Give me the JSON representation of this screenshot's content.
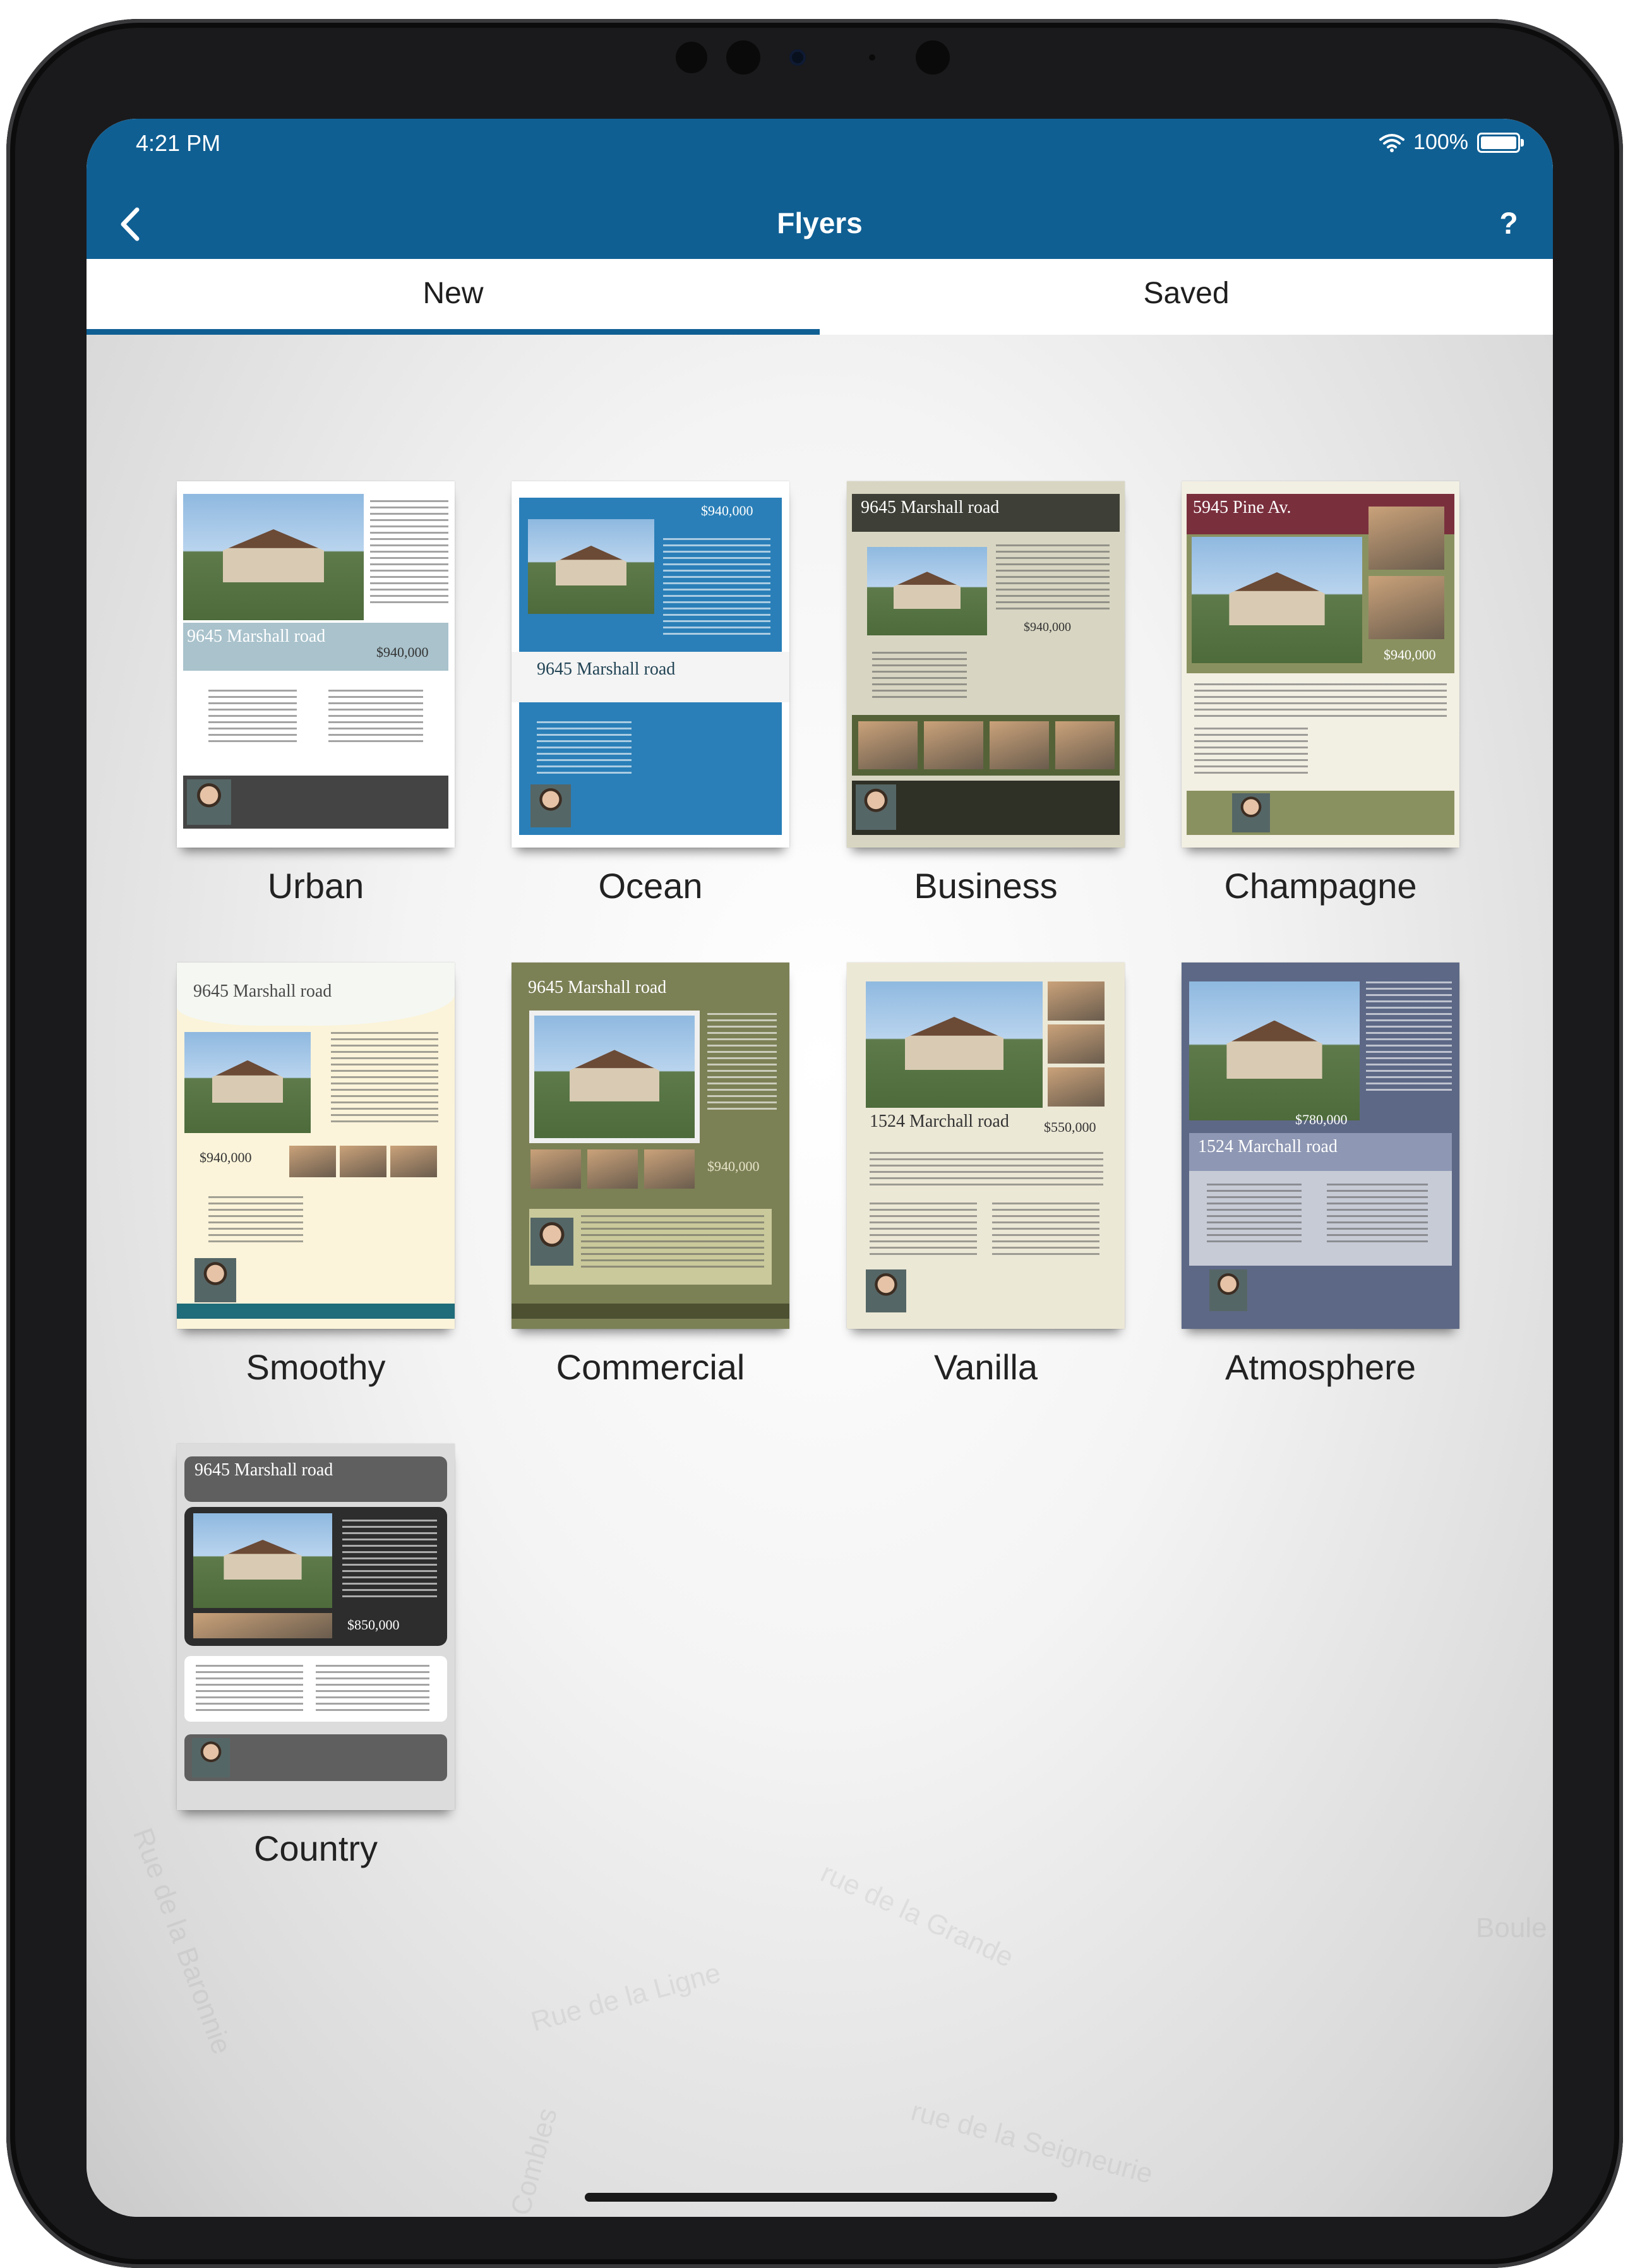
{
  "status_bar": {
    "time": "4:21 PM",
    "battery": "100%"
  },
  "nav": {
    "title": "Flyers",
    "help": "?"
  },
  "tabs": [
    {
      "label": "New",
      "active": true
    },
    {
      "label": "Saved",
      "active": false
    }
  ],
  "templates": [
    {
      "name": "Urban",
      "thumb": {
        "title": "9645 Marshall road",
        "price": "$940,000"
      }
    },
    {
      "name": "Ocean",
      "thumb": {
        "title": "9645 Marshall road",
        "price": "$940,000"
      }
    },
    {
      "name": "Business",
      "thumb": {
        "title": "9645 Marshall road",
        "price": "$940,000"
      }
    },
    {
      "name": "Champagne",
      "thumb": {
        "title": "5945 Pine Av.",
        "price": "$940,000"
      }
    },
    {
      "name": "Smoothy",
      "thumb": {
        "title": "9645 Marshall road",
        "price": "$940,000"
      }
    },
    {
      "name": "Commercial",
      "thumb": {
        "title": "9645 Marshall road",
        "price": "$940,000"
      }
    },
    {
      "name": "Vanilla",
      "thumb": {
        "title": "1524 Marchall road",
        "price": "$550,000"
      }
    },
    {
      "name": "Atmosphere",
      "thumb": {
        "title": "1524 Marchall road",
        "price": "$780,000"
      }
    },
    {
      "name": "Country",
      "thumb": {
        "title": "9645 Marshall road",
        "price": "$850,000"
      }
    }
  ],
  "background_map_labels": [
    "Rue de la Baronnie",
    "Rue de la Ligne",
    "des Combles",
    "rue de la Seigneurie",
    "rue de la Grande",
    "Boule"
  ],
  "colors": {
    "accent": "#0f5f93"
  }
}
